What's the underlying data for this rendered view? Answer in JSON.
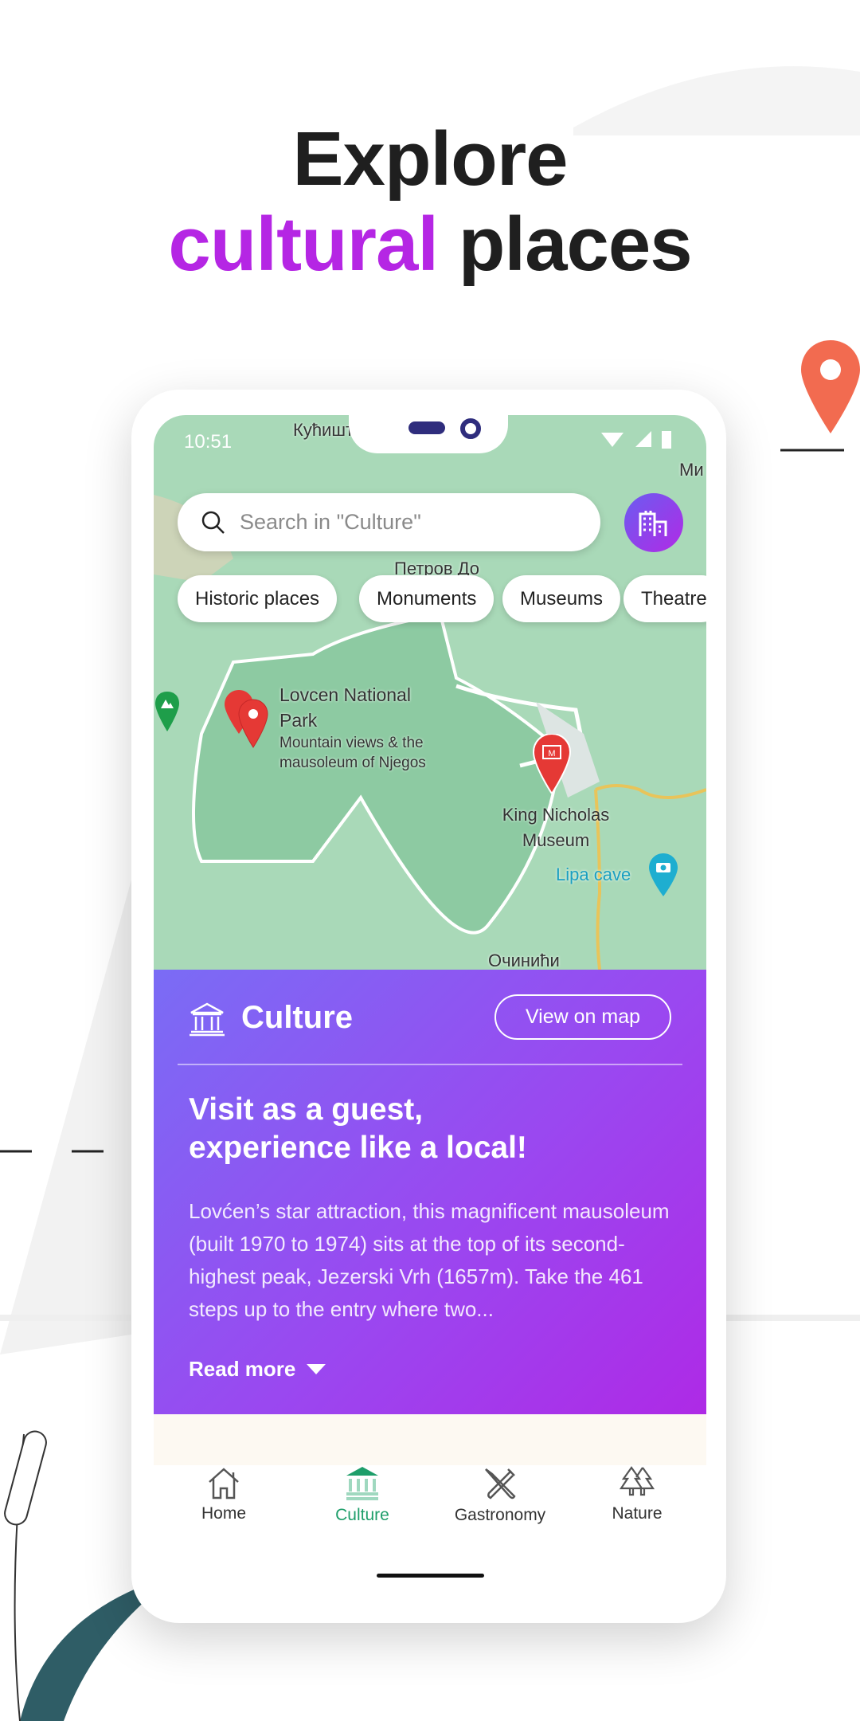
{
  "headline": {
    "line1": "Explore",
    "accent": "cultural",
    "rest": "places"
  },
  "status_bar": {
    "time": "10:51"
  },
  "search": {
    "placeholder": "Search in \"Culture\""
  },
  "chips": [
    "Historic places",
    "Monuments",
    "Museums",
    "Theatre"
  ],
  "map": {
    "places": [
      {
        "name": "Lovcen National Park",
        "description": "Mountain views & the mausoleum of Njegos"
      },
      {
        "name": "King Nicholas Museum"
      },
      {
        "name": "Lipa cave"
      }
    ],
    "labels": [
      "Кућишт",
      "Петров До",
      "Очинићи",
      "Ми"
    ]
  },
  "card": {
    "title": "Culture",
    "view_on_map": "View on map",
    "heading": "Visit as a guest, experience like a local!",
    "body": "Lovćen’s star attraction, this magnificent mausoleum (built 1970 to 1974) sits at the top of its second-highest peak, Jezerski Vrh (1657m). Take the 461 steps up to the entry where two...",
    "read_more": "Read more"
  },
  "nav": [
    {
      "label": "Home",
      "icon": "home-icon"
    },
    {
      "label": "Culture",
      "icon": "museum-icon",
      "active": true
    },
    {
      "label": "Gastronomy",
      "icon": "cutlery-icon"
    },
    {
      "label": "Nature",
      "icon": "trees-icon"
    }
  ],
  "colors": {
    "accent": "#b526e4",
    "nav_active": "#1e9e6a",
    "pin_red": "#e53935",
    "orange_pin": "#f26b50"
  }
}
